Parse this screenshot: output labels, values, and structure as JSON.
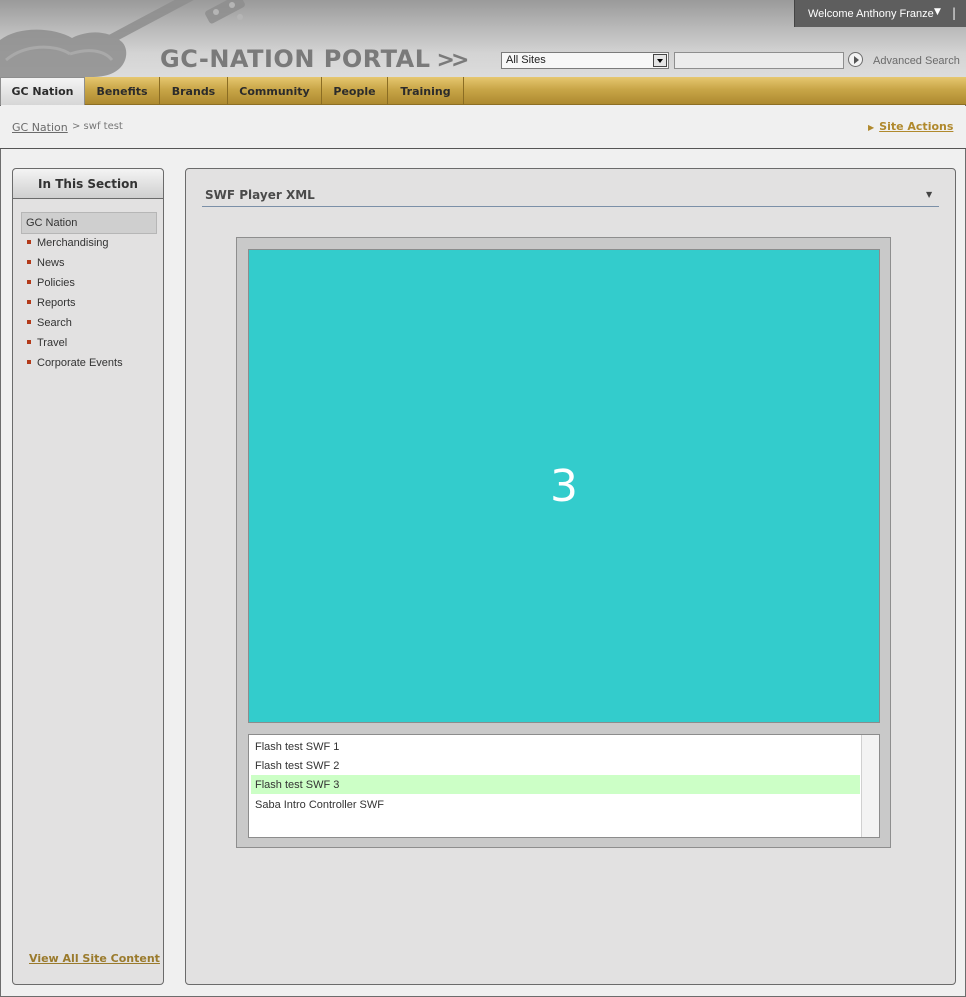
{
  "header": {
    "portal_title": "GC-NATION PORTAL",
    "welcome_text": "Welcome Anthony Franze",
    "welcome_separator": "|",
    "search_scope": "All Sites",
    "search_value": "",
    "advanced_search": "Advanced Search"
  },
  "nav": {
    "tabs": [
      {
        "label": "GC Nation",
        "active": true
      },
      {
        "label": "Benefits",
        "active": false
      },
      {
        "label": "Brands",
        "active": false
      },
      {
        "label": "Community",
        "active": false
      },
      {
        "label": "People",
        "active": false
      },
      {
        "label": "Training",
        "active": false
      }
    ]
  },
  "breadcrumb": {
    "root": "GC Nation",
    "current": "> swf test"
  },
  "site_actions": "Site Actions",
  "leftnav": {
    "title": "In This Section",
    "root": "GC Nation",
    "items": [
      "Merchandising",
      "News",
      "Policies",
      "Reports",
      "Search",
      "Travel",
      "Corporate Events"
    ],
    "view_all": "View All Site Content"
  },
  "webpart": {
    "title": "SWF Player XML",
    "slide_number": "3",
    "playlist": [
      {
        "label": "Flash test SWF 1",
        "selected": false
      },
      {
        "label": "Flash test SWF 2",
        "selected": false
      },
      {
        "label": "Flash test SWF 3",
        "selected": true
      },
      {
        "label": "Saba Intro Controller SWF",
        "selected": false
      }
    ]
  },
  "colors": {
    "nav_gold": "#c9a648",
    "player_stage": "#33cccc",
    "selected_row": "#ccffc6",
    "bullet": "#b23a1a",
    "site_actions": "#b0892d"
  }
}
